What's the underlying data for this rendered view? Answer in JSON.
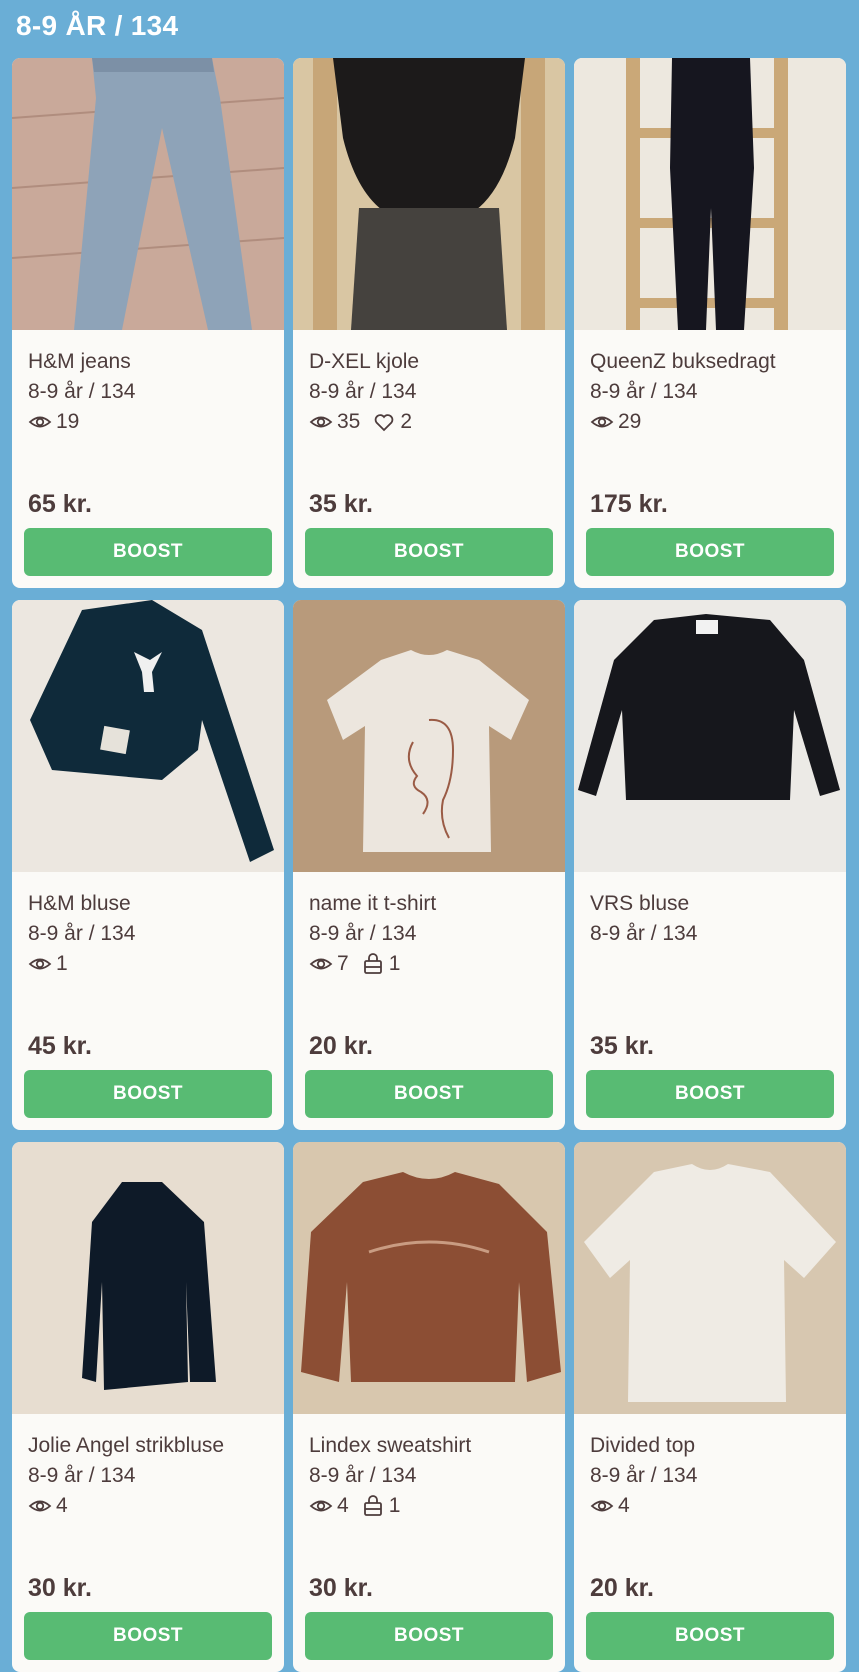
{
  "header": {
    "title": "8-9 ÅR / 134"
  },
  "items": [
    {
      "title": "H&M jeans",
      "size": "8-9 år / 134",
      "views": "19",
      "likes": null,
      "sold": null,
      "price": "65 kr.",
      "boost_label": "BOOST",
      "photo": "jeans"
    },
    {
      "title": "D-XEL kjole",
      "size": "8-9 år / 134",
      "views": "35",
      "likes": "2",
      "sold": null,
      "price": "35 kr.",
      "boost_label": "BOOST",
      "photo": "dress"
    },
    {
      "title": "QueenZ buksedragt",
      "size": "8-9 år / 134",
      "views": "29",
      "likes": null,
      "sold": null,
      "price": "175 kr.",
      "boost_label": "BOOST",
      "photo": "jumpsuit"
    },
    {
      "title": "H&M bluse",
      "size": "8-9 år / 134",
      "views": "1",
      "likes": null,
      "sold": null,
      "price": "45 kr.",
      "boost_label": "BOOST",
      "photo": "navy-blouse"
    },
    {
      "title": "name it t-shirt",
      "size": "8-9 år / 134",
      "views": "7",
      "likes": null,
      "sold": "1",
      "price": "20 kr.",
      "boost_label": "BOOST",
      "photo": "face-tshirt"
    },
    {
      "title": "VRS bluse",
      "size": "8-9 år / 134",
      "views": null,
      "likes": null,
      "sold": null,
      "price": "35 kr.",
      "boost_label": "BOOST",
      "photo": "black-blouse"
    },
    {
      "title": "Jolie Angel strikbluse",
      "size": "8-9 år / 134",
      "views": "4",
      "likes": null,
      "sold": null,
      "price": "30 kr.",
      "boost_label": "BOOST",
      "photo": "knit-top"
    },
    {
      "title": "Lindex sweatshirt",
      "size": "8-9 år / 134",
      "views": "4",
      "likes": null,
      "sold": "1",
      "price": "30 kr.",
      "boost_label": "BOOST",
      "photo": "sweatshirt"
    },
    {
      "title": "Divided top",
      "size": "8-9 år / 134",
      "views": "4",
      "likes": null,
      "sold": null,
      "price": "20 kr.",
      "boost_label": "BOOST",
      "photo": "white-top"
    }
  ],
  "icons": {
    "views": "eye-icon",
    "likes": "heart-icon",
    "sold": "bag-icon"
  },
  "colors": {
    "background": "#6aaed6",
    "boost": "#58bb73",
    "text": "#4d3c3c",
    "card": "#fbfaf7"
  }
}
